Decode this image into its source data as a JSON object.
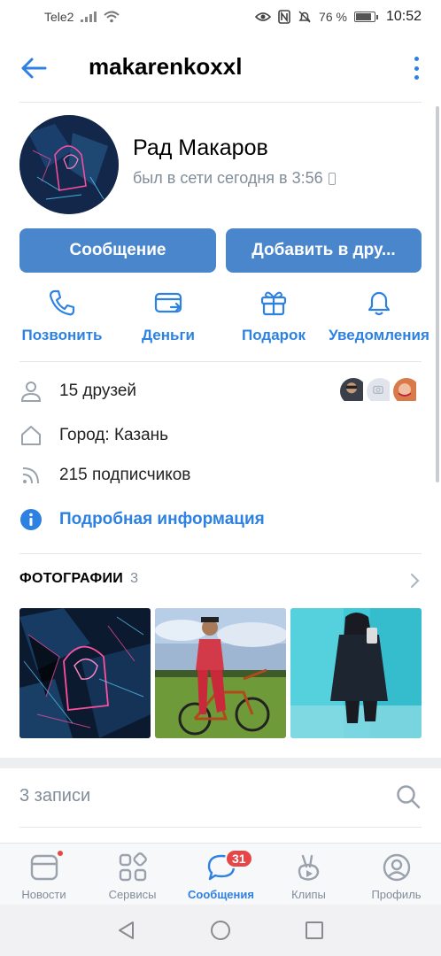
{
  "status_bar": {
    "carrier": "Tele2",
    "battery": "76 %",
    "battery_level": 0.76,
    "time": "10:52",
    "icons": [
      "signal-icon",
      "wifi-icon",
      "eye-icon",
      "nfc-icon",
      "mute-icon",
      "battery-icon"
    ]
  },
  "header": {
    "title": "makarenkoxxl",
    "back_icon": "arrow-left-icon",
    "more_icon": "more-vertical-icon"
  },
  "profile": {
    "name": "Рад Макаров",
    "last_seen": "был в сети сегодня в 3:56",
    "last_seen_icon": "phone-icon"
  },
  "buttons": {
    "message": "Сообщение",
    "add_friend": "Добавить в дру..."
  },
  "actions": [
    {
      "label": "Позвонить",
      "icon": "phone-icon"
    },
    {
      "label": "Деньги",
      "icon": "money-transfer-icon"
    },
    {
      "label": "Подарок",
      "icon": "gift-icon"
    },
    {
      "label": "Уведомления",
      "icon": "bell-icon"
    }
  ],
  "info": {
    "friends": "15 друзей",
    "city": "Город: Казань",
    "followers": "215 подписчиков",
    "details_link": "Подробная информация"
  },
  "photos": {
    "title": "ФОТОГРАФИИ",
    "count": "3"
  },
  "posts": {
    "title": "3 записи"
  },
  "tabbar": {
    "items": [
      {
        "label": "Новости",
        "icon": "news-icon"
      },
      {
        "label": "Сервисы",
        "icon": "services-icon"
      },
      {
        "label": "Сообщения",
        "icon": "messages-icon",
        "badge": "31"
      },
      {
        "label": "Клипы",
        "icon": "clips-icon"
      },
      {
        "label": "Профиль",
        "icon": "profile-icon"
      }
    ]
  },
  "colors": {
    "accent": "#2d81e0",
    "button": "#4a86cb",
    "secondary_text": "#818c99",
    "badge": "#e64646"
  }
}
